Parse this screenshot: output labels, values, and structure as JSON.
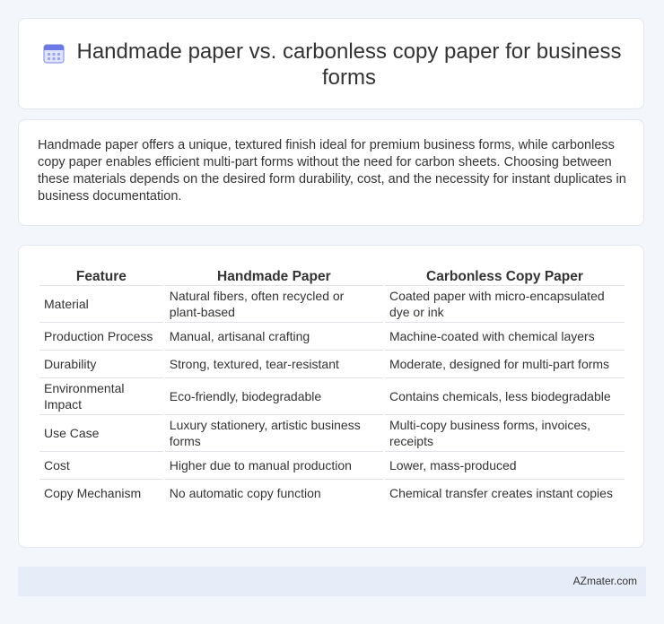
{
  "header": {
    "icon": "calendar-icon",
    "title": "Handmade paper vs. carbonless copy paper for business forms"
  },
  "intro": {
    "text": "Handmade paper offers a unique, textured finish ideal for premium business forms, while carbonless copy paper enables efficient multi-part forms without the need for carbon sheets. Choosing between these materials depends on the desired form durability, cost, and the necessity for instant duplicates in business documentation."
  },
  "table": {
    "headers": [
      "Feature",
      "Handmade Paper",
      "Carbonless Copy Paper"
    ],
    "rows": [
      [
        "Material",
        "Natural fibers, often recycled or plant-based",
        "Coated paper with micro-encapsulated dye or ink"
      ],
      [
        "Production Process",
        "Manual, artisanal crafting",
        "Machine-coated with chemical layers"
      ],
      [
        "Durability",
        "Strong, textured, tear-resistant",
        "Moderate, designed for multi-part forms"
      ],
      [
        "Environmental Impact",
        "Eco-friendly, biodegradable",
        "Contains chemicals, less biodegradable"
      ],
      [
        "Use Case",
        "Luxury stationery, artistic business forms",
        "Multi-copy business forms, invoices, receipts"
      ],
      [
        "Cost",
        "Higher due to manual production",
        "Lower, mass-produced"
      ],
      [
        "Copy Mechanism",
        "No automatic copy function",
        "Chemical transfer creates instant copies"
      ]
    ]
  },
  "footer": {
    "source": "AZmater.com"
  },
  "colors": {
    "page_background": "#f3f6fb",
    "card_background": "#ffffff",
    "footer_background": "#e6edf8",
    "icon_accent": "#6b79e6"
  }
}
